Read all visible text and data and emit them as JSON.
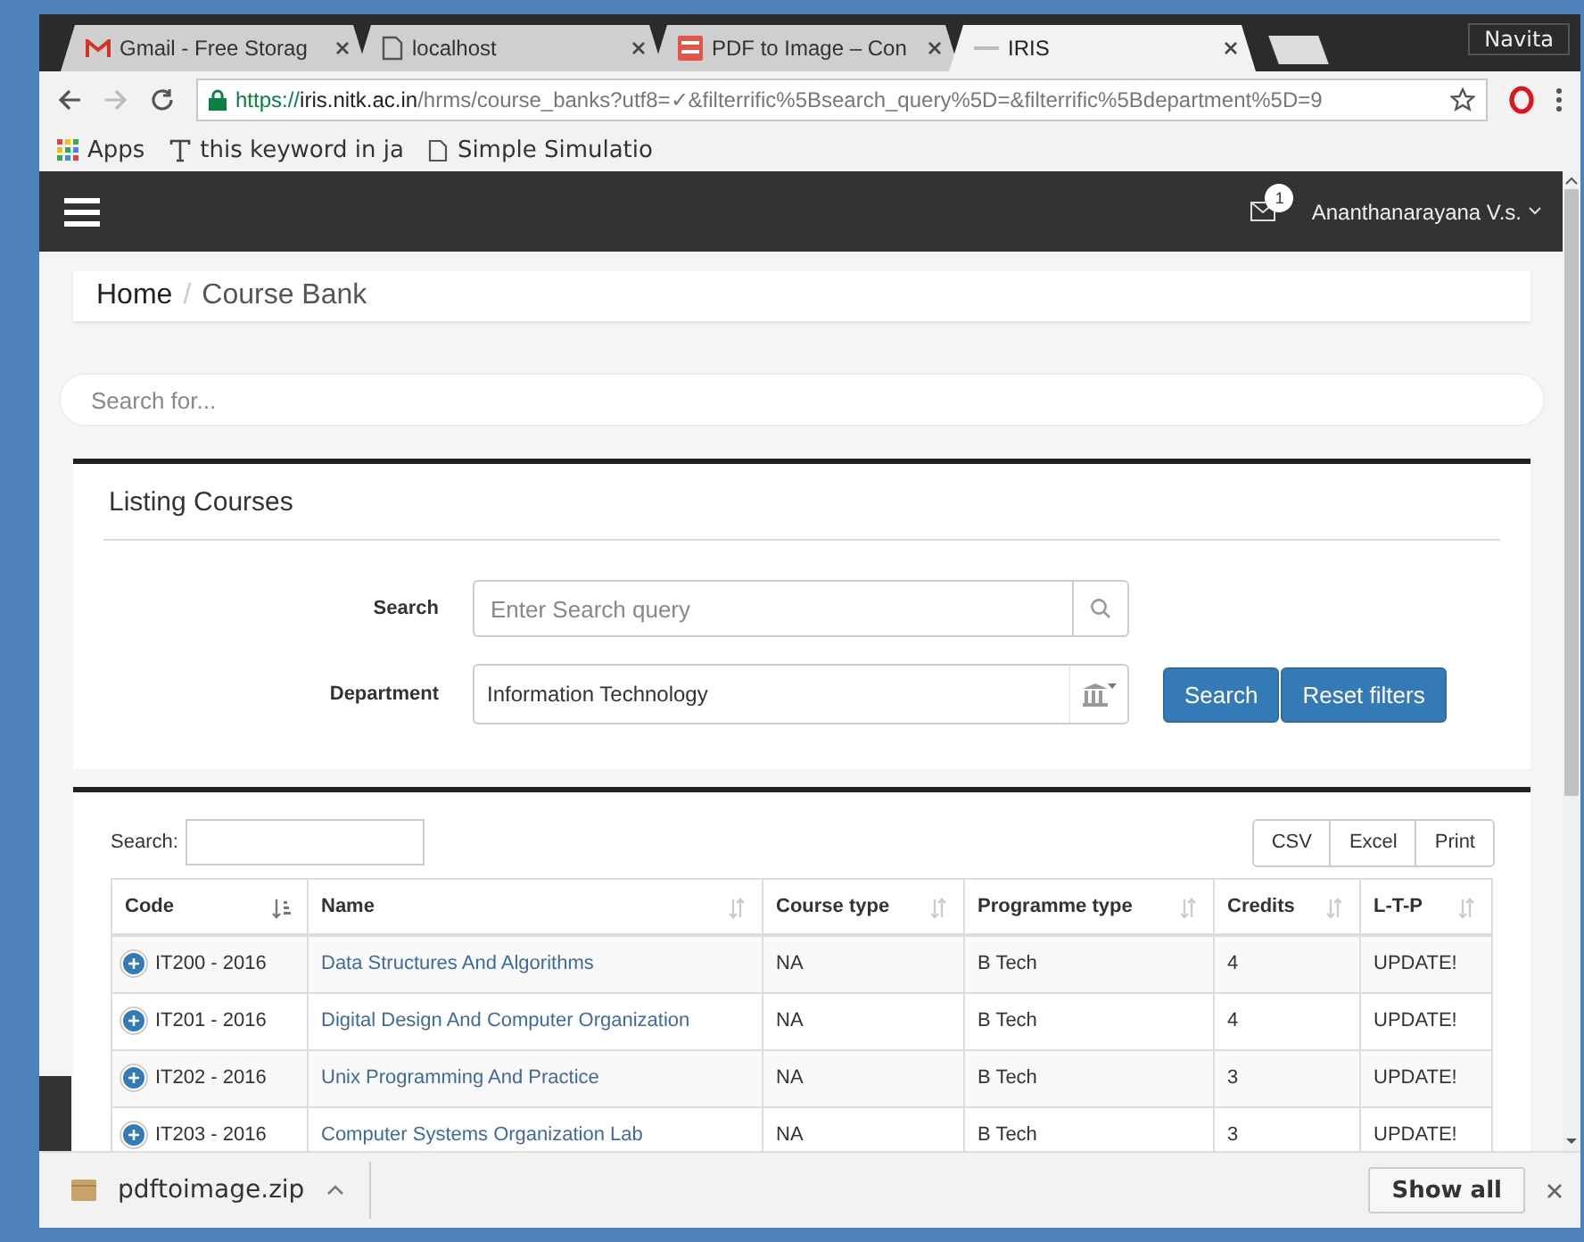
{
  "browser": {
    "tabs": [
      {
        "kind": "gmail",
        "title": "Gmail - Free Storag",
        "selected": false
      },
      {
        "kind": "page",
        "title": "localhost",
        "selected": false
      },
      {
        "kind": "pdf",
        "title": "PDF to Image – Con",
        "selected": false
      },
      {
        "kind": "iris",
        "title": "IRIS",
        "selected": true
      }
    ],
    "profile": "Navita",
    "url": {
      "scheme": "https://",
      "host": "iris.nitk.ac.in",
      "path": "/hrms/course_banks?utf8=✓&filterrific%5Bsearch_query%5D=&filterrific%5Bdepartment%5D=9"
    },
    "bookmarks": [
      {
        "kind": "apps",
        "label": "Apps"
      },
      {
        "kind": "font",
        "label": "this keyword in ja"
      },
      {
        "kind": "page",
        "label": "Simple Simulatio"
      }
    ]
  },
  "navbar": {
    "notifications": "1",
    "user": "Ananthanarayana V.s."
  },
  "breadcrumb": [
    {
      "label": "Home",
      "selected": false
    },
    {
      "separator": "/",
      "label": "Course Bank",
      "selected": true
    }
  ],
  "global_search": {
    "placeholder": "Search for..."
  },
  "filters": {
    "title": "Listing Courses",
    "search_label": "Search",
    "search_placeholder": "Enter Search query",
    "department_label": "Department",
    "department_value": "Information Technology",
    "buttons": [
      {
        "kind": "primary",
        "label": "Search"
      },
      {
        "kind": "primary",
        "label": "Reset filters"
      }
    ]
  },
  "table": {
    "search_label": "Search:",
    "exports": [
      "CSV",
      "Excel",
      "Print"
    ],
    "columns": [
      {
        "label": "Code",
        "sorted": true
      },
      {
        "label": "Name",
        "sorted": false
      },
      {
        "label": "Course type",
        "sorted": false
      },
      {
        "label": "Programme type",
        "sorted": false
      },
      {
        "label": "Credits",
        "sorted": false
      },
      {
        "label": "L-T-P",
        "sorted": false
      }
    ],
    "rows": [
      [
        "IT200 - 2016",
        "Data Structures And Algorithms",
        "NA",
        "B Tech",
        "4",
        "UPDATE!"
      ],
      [
        "IT201 - 2016",
        "Digital Design And Computer Organization",
        "NA",
        "B Tech",
        "4",
        "UPDATE!"
      ],
      [
        "IT202 - 2016",
        "Unix Programming And Practice",
        "NA",
        "B Tech",
        "3",
        "UPDATE!"
      ],
      [
        "IT203 - 2016",
        "Computer Systems Organization Lab",
        "NA",
        "B Tech",
        "3",
        "UPDATE!"
      ]
    ]
  },
  "downloads": {
    "file": "pdftoimage.zip",
    "show_all": "Show all"
  }
}
